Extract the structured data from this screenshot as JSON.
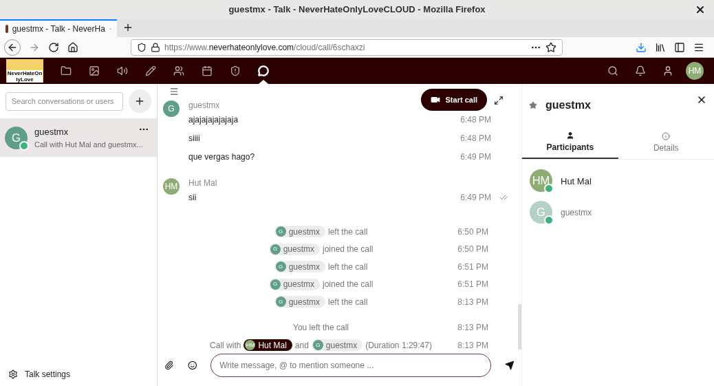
{
  "window": {
    "title": "guestmx - Talk - NeverHateOnlyLoveCLOUD - Mozilla Firefox"
  },
  "browser": {
    "tabs": [
      {
        "title": "guestmx - Talk - NeverHa",
        "selected": true
      }
    ],
    "url": {
      "prefix": "https://www.",
      "domain": "neverhateonlylove.com",
      "path": "/cloud/call/6schaxzi"
    }
  },
  "header": {
    "logo_text": "NeverHateOnlyLove",
    "apps": [
      {
        "kind": "files",
        "selected": false
      },
      {
        "kind": "photos",
        "selected": false
      },
      {
        "kind": "audio",
        "selected": false
      },
      {
        "kind": "notes",
        "selected": false
      },
      {
        "kind": "contacts",
        "selected": false
      },
      {
        "kind": "calendar",
        "selected": false
      },
      {
        "kind": "badge",
        "selected": false
      },
      {
        "kind": "talk",
        "selected": true
      }
    ],
    "avatar": "HM"
  },
  "sidebar": {
    "search_placeholder": "Search conversations or users",
    "conversations": [
      {
        "name": "guestmx",
        "subtitle": "Call with Hut Mal and guestmx...",
        "avatar": "G",
        "color": "#5f9e89",
        "online": true,
        "selected": true
      }
    ],
    "settings_label": "Talk settings"
  },
  "chat": {
    "start_call": "Start call",
    "groups": [
      {
        "author": "guestmx",
        "avatar": "G",
        "color": "#5f9e89",
        "messages": [
          {
            "text": "ajajajajajajaja",
            "time": "6:48 PM",
            "seen": false
          },
          {
            "text": "siiii",
            "time": "6:48 PM",
            "seen": false
          },
          {
            "text": "que vergas hago?",
            "time": "6:49 PM",
            "seen": false
          }
        ]
      },
      {
        "author": "Hut Mal",
        "avatar": "HM",
        "color": "#8fac74",
        "messages": [
          {
            "text": "sii",
            "time": "6:49 PM",
            "seen": true
          }
        ]
      }
    ],
    "system": [
      {
        "parts": [
          {
            "kind": "mention",
            "name": "guestmx",
            "avatar": "G",
            "self": false
          },
          {
            "kind": "text",
            "text": "left the call"
          }
        ],
        "time": "6:50 PM"
      },
      {
        "parts": [
          {
            "kind": "mention",
            "name": "guestmx",
            "avatar": "G",
            "self": false
          },
          {
            "kind": "text",
            "text": "joined the call"
          }
        ],
        "time": "6:50 PM"
      },
      {
        "parts": [
          {
            "kind": "mention",
            "name": "guestmx",
            "avatar": "G",
            "self": false
          },
          {
            "kind": "text",
            "text": "left the call"
          }
        ],
        "time": "6:51 PM"
      },
      {
        "parts": [
          {
            "kind": "mention",
            "name": "guestmx",
            "avatar": "G",
            "self": false
          },
          {
            "kind": "text",
            "text": "joined the call"
          }
        ],
        "time": "6:51 PM"
      },
      {
        "parts": [
          {
            "kind": "mention",
            "name": "guestmx",
            "avatar": "G",
            "self": false
          },
          {
            "kind": "text",
            "text": "left the call"
          }
        ],
        "time": "8:13 PM"
      },
      {
        "parts": [
          {
            "kind": "text",
            "text": "You left the call"
          }
        ],
        "time": "8:13 PM"
      },
      {
        "parts": [
          {
            "kind": "text",
            "text": "Call with"
          },
          {
            "kind": "mention",
            "name": "Hut Mal",
            "avatar": "HM",
            "self": true
          },
          {
            "kind": "text",
            "text": "and"
          },
          {
            "kind": "mention",
            "name": "guestmx",
            "avatar": "G",
            "self": false
          },
          {
            "kind": "text",
            "text": "(Duration 1:29:47)"
          }
        ],
        "time": "8:13 PM"
      }
    ],
    "composer_placeholder": "Write message, @ to mention someone ..."
  },
  "details": {
    "title": "guestmx",
    "favorite": false,
    "tabs": [
      {
        "label": "Participants",
        "kind": "participants",
        "selected": true
      },
      {
        "label": "Details",
        "kind": "details",
        "selected": false
      }
    ],
    "participants": [
      {
        "name": "Hut Mal",
        "avatar": "HM",
        "color": "#8fac74",
        "online": true,
        "guest": false
      },
      {
        "name": "guestmx",
        "avatar": "G",
        "color": "#b5d1c6",
        "online": true,
        "guest": true
      }
    ]
  }
}
